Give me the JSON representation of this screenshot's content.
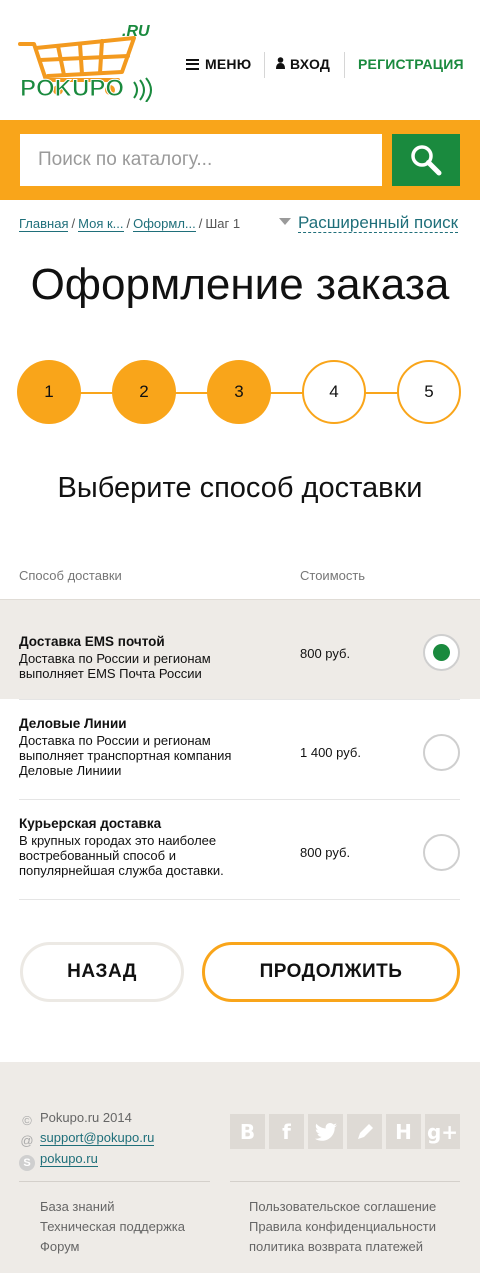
{
  "header": {
    "logo_text": "POKUPO",
    "logo_suffix": ".RU",
    "menu_label": "МЕНЮ",
    "login_label": "ВХОД",
    "register_label": "РЕГИСТРАЦИЯ"
  },
  "search": {
    "placeholder": "Поиск по каталогу..."
  },
  "breadcrumb": {
    "items": [
      "Главная",
      "Моя к...",
      "Оформл...",
      "Шаг 1"
    ],
    "advanced_search": "Расширенный поиск"
  },
  "page_title": "Оформление заказа",
  "steps": [
    "1",
    "2",
    "3",
    "4",
    "5"
  ],
  "steps_completed": 3,
  "subheading": "Выберите способ доставки",
  "table": {
    "col_method": "Способ доставки",
    "col_cost": "Стоимость",
    "rows": [
      {
        "name": "Доставка EMS почтой",
        "desc": "Доставка по России и регионам выполняет EMS Почта России",
        "price": "800 руб.",
        "selected": true
      },
      {
        "name": "Деловые Линии",
        "desc": "Доставка по России и регионам выполняет транспортная компания Деловые Линиии",
        "price": "1 400 руб.",
        "selected": false
      },
      {
        "name": "Курьерская доставка",
        "desc": "В крупных городах это наиболее востребованный способ и популярнейшая служба доставки.",
        "price": "800 руб.",
        "selected": false
      }
    ]
  },
  "buttons": {
    "back": "НАЗАД",
    "next": "ПРОДОЛЖИТЬ"
  },
  "footer": {
    "copyright": "Pokupo.ru 2014",
    "email": "support@pokupo.ru",
    "skype": "pokupo.ru",
    "socials": [
      "vk-icon",
      "facebook-icon",
      "twitter-icon",
      "livejournal-icon",
      "habr-icon",
      "googleplus-icon"
    ],
    "social_glyphs": [
      "B",
      "f",
      "",
      "",
      "H",
      "g+"
    ],
    "links_left": [
      "База знаний",
      "Техническая поддержка",
      "Форум"
    ],
    "links_right": [
      "Пользовательское соглашение",
      "Правила конфиденциальности",
      "политика возврата платежей"
    ]
  },
  "colors": {
    "accent_orange": "#f9a51a",
    "brand_green": "#1a8a3e",
    "link_teal": "#1f6f7a",
    "footer_bg": "#eeebe7"
  }
}
